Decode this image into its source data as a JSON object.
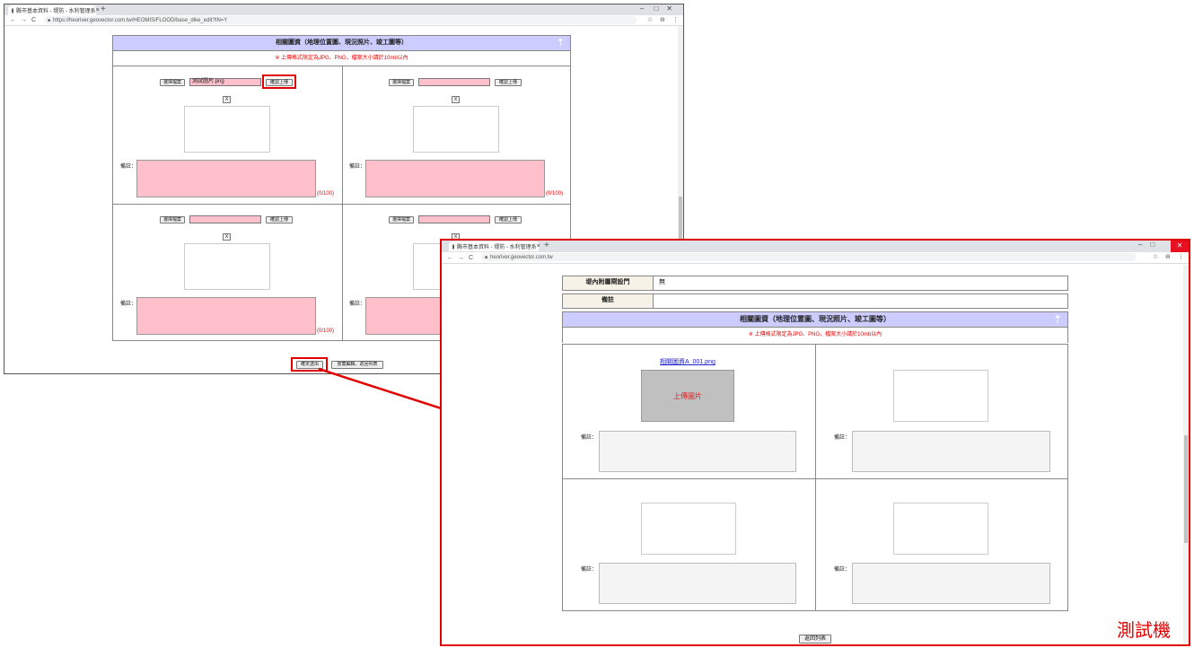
{
  "left_window": {
    "tab_title": "縣市基本資料 - 堤防 - 水利管理系",
    "url": "https://heoriver.geovector.com.tw/HEOMIS/FLOOD/base_dike_edit?IN=Y",
    "section_title": "相關圖資（地理位置圖、現況照片、竣工圖等）",
    "upload_note": "※ 上傳格式限定為JPG、PNG，檔案大小請於10mb以內",
    "choose_file_label": "選擇檔案",
    "confirm_upload_label": "確認上傳",
    "remove_label": "X",
    "remark_label": "備註：",
    "counter": "(0/100)",
    "file_name_1": "測試圖片.png",
    "confirm_submit_label": "確定送出",
    "abandon_label": "放棄編輯，返回列表"
  },
  "right_window": {
    "tab_title": "縣市基本資料 - 堤防 - 水利管理系",
    "url": "heoriver.geovector.com.tw",
    "row1_key": "堤內附屬閘設門",
    "row1_value": "無",
    "row2_key": "備註",
    "row2_value": "",
    "section_title": "相關圖資（地理位置圖、現況照片、竣工圖等）",
    "upload_note": "※ 上傳格式限定為JPG、PNG，檔案大小請於10mb以內",
    "file_link": "相關圖資A_001.png",
    "image_caption": "上傳圖片",
    "remark_label": "備註：",
    "back_label": "返回列表"
  },
  "stamp": "測試機",
  "colors": {
    "header_bg": "#ccccff",
    "pink_field": "#ffc0cb",
    "red_annotation": "#e00000"
  }
}
